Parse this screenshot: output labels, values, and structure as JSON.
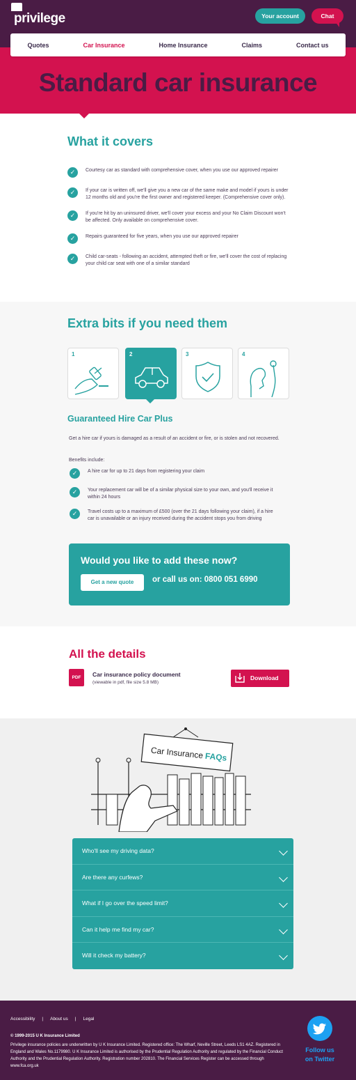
{
  "header": {
    "logo": "privilege",
    "account_label": "Your account",
    "chat_label": "Chat"
  },
  "nav": {
    "items": [
      {
        "label": "Quotes"
      },
      {
        "label": "Car Insurance",
        "active": true
      },
      {
        "label": "Home Insurance"
      },
      {
        "label": "Claims"
      },
      {
        "label": "Contact us"
      }
    ]
  },
  "hero": {
    "title": "Standard car insurance"
  },
  "covers": {
    "title": "What it covers",
    "items": [
      "Courtesy car as standard with comprehensive cover, when you use our approved repairer",
      "If your car is written off, we'll give you a new car of the same make and model if yours is under 12 months old and you're the first owner and registered keeper. (Comprehensive cover only).",
      "If you're hit by an uninsured driver, we'll cover your excess and your No Claim Discount won't be affected. Only available on comprehensive cover.",
      "Repairs guaranteed for five years, when you use our approved repairer",
      "Child car-seats - following an accident, attempted theft or fire, we'll cover the cost of replacing your child car seat with one of a similar standard"
    ]
  },
  "extras": {
    "title": "Extra bits if you need them",
    "cards": [
      {
        "num": "1",
        "icon": "gavel-icon"
      },
      {
        "num": "2",
        "icon": "car-icon",
        "active": true
      },
      {
        "num": "3",
        "icon": "shield-check-icon"
      },
      {
        "num": "4",
        "icon": "mechanic-icon"
      }
    ],
    "product_title": "Guaranteed Hire Car Plus",
    "product_desc": "Get a hire car if yours is damaged as a result of an accident or fire, or is stolen and not recovered.",
    "benefits_label": "Benefits include:",
    "benefits": [
      "A hire car for up to 21 days from registering your claim",
      "Your replacement car will be of a similar physical size to your own, and you'll receive it within 24 hours",
      "Travel costs up to a maximum of £500 (over the 21 days following your claim), if a hire car is unavailable or an injury received during the accident stops you from driving"
    ]
  },
  "cta": {
    "title": "Would you like to add these now?",
    "button": "Get a new quote",
    "call": "or call us on: 0800 051 6990"
  },
  "details": {
    "title": "All the details",
    "pdf_badge": "PDF",
    "doc_title": "Car insurance policy document",
    "doc_sub": "(viewable in pdf, file size 5.8 MB)",
    "download": "Download"
  },
  "faq": {
    "sign_text": "Car Insurance",
    "sign_highlight": "FAQs",
    "items": [
      "Who'll see my driving data?",
      "Are there any curfews?",
      "What if I go over the speed limit?",
      "Can it help me find my car?",
      "Will it check my battery?"
    ]
  },
  "footer": {
    "links": [
      "Accessibility",
      "About us",
      "Legal"
    ],
    "copyright": "© 1999-2015 U K Insurance Limited",
    "legal": "Privilege insurance policies are underwritten by U K Insurance Limited. Registered office: The Wharf, Neville Street, Leeds LS1 4AZ. Registered in England and Wales No.1179980. U K Insurance Limited is authorised by the Prudential Regulation Authority and regulated by the Financial Conduct Authority and the Prudential Regulation Authority. Registration number 202810. The Financial Services Register can be accessed through www.fca.org.uk",
    "twitter": "Follow us on Twitter"
  },
  "colors": {
    "brand_purple": "#4a1c45",
    "brand_pink": "#d3124f",
    "accent_teal": "#27a2a0",
    "twitter_blue": "#1da1f2"
  }
}
